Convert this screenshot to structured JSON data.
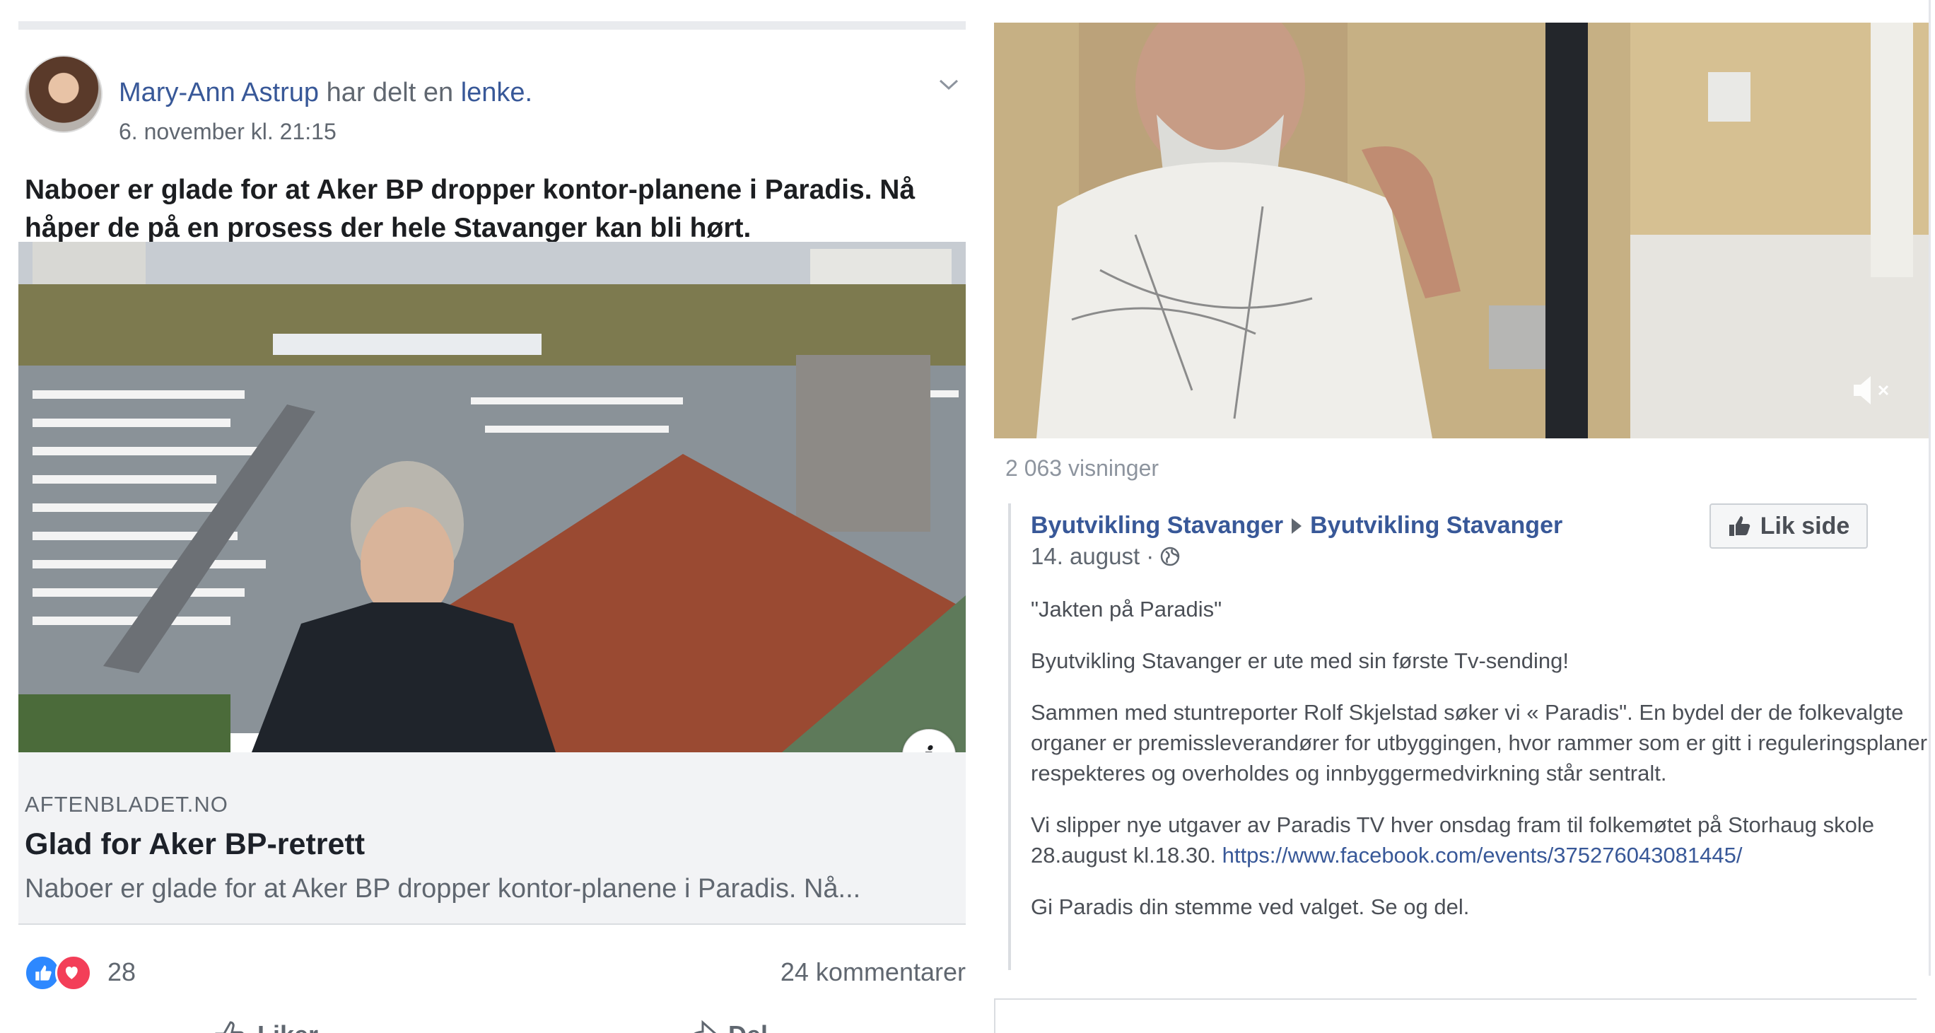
{
  "left_post": {
    "author": "Mary-Ann Astrup",
    "shared_text": "har delt en",
    "shared_link_word": "lenke.",
    "timestamp": "6. november kl. 21:15",
    "text": "Naboer er glade for at Aker BP dropper kontor-planene i Paradis. Nå håper de på en prosess der hele Stavanger kan bli hørt.",
    "link_card": {
      "domain": "AFTENBLADET.NO",
      "title": "Glad for Aker BP-retrett",
      "description": "Naboer er glade for at Aker BP dropper kontor-planene i Paradis. Nå..."
    },
    "reactions": {
      "count": "28",
      "comments": "24 kommentarer"
    },
    "actions": {
      "like": "Liker",
      "share": "Del"
    },
    "info_glyph": "i"
  },
  "right_post": {
    "views": "2 063 visninger",
    "page_from": "Byutvikling Stavanger",
    "page_to": "Byutvikling Stavanger",
    "like_page": "Lik side",
    "date": "14. august ·",
    "paragraphs": [
      "\"Jakten på Paradis\"",
      "Byutvikling Stavanger er ute med sin første Tv-sending!",
      "Sammen med stuntreporter Rolf Skjelstad søker vi « Paradis\". En bydel der de folkevalgte organer er premissleverandører for utbyggingen, hvor rammer som er gitt i reguleringsplaner respekteres og overholdes og innbyggermedvirkning står sentralt.",
      "Gi Paradis din stemme ved valget. Se og del."
    ],
    "event_paragraph": "Vi slipper nye utgaver av Paradis TV hver onsdag fram til folkemøtet på Storhaug skole 28.august kl.18.30.",
    "event_url": "https://www.facebook.com/events/375276043081445/"
  },
  "colors": {
    "link_blue": "#385898",
    "like_blue": "#2d88ff",
    "love_red": "#f33e58",
    "muted": "#606770"
  }
}
